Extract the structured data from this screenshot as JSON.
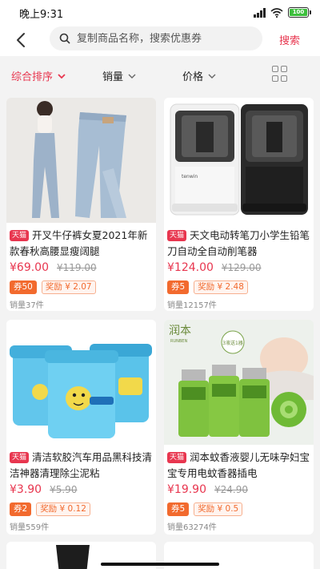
{
  "status": {
    "time": "晚上9:31",
    "battery": "100"
  },
  "search": {
    "placeholder": "复制商品名称，搜索优惠券",
    "button_label": "搜索"
  },
  "sort": {
    "items": [
      "综合排序",
      "销量",
      "价格"
    ]
  },
  "products": [
    {
      "badge": "天猫",
      "title": "开叉牛仔裤女夏2021年新款春秋高腰显瘦阔腿",
      "price": "¥69.00",
      "original_price": "¥119.00",
      "coupon": "券50",
      "reward": "奖励 ¥ 2.07",
      "sales": "销量37件"
    },
    {
      "badge": "天猫",
      "title": "天文电动转笔刀小学生铅笔刀自动全自动削笔器",
      "price": "¥124.00",
      "original_price": "¥129.00",
      "coupon": "券5",
      "reward": "奖励 ¥ 2.48",
      "sales": "销量12157件",
      "brand_on_image": "tenwin"
    },
    {
      "badge": "天猫",
      "title": "清洁软胶汽车用品黑科技清洁神器清理除尘泥粘",
      "price": "¥3.90",
      "original_price": "¥5.90",
      "coupon": "券2",
      "reward": "奖励 ¥ 0.12",
      "sales": "销量559件"
    },
    {
      "badge": "天猫",
      "title": "润本蚊香液婴儿无味孕妇宝宝专用电蚊香器插电",
      "price": "¥19.90",
      "original_price": "¥24.90",
      "coupon": "券5",
      "reward": "奖励 ¥ 0.5",
      "sales": "销量63274件",
      "brand_on_image": "润本",
      "brand_sub": "RUNBEN",
      "promo_on_image": "3液送1器"
    }
  ],
  "colors": {
    "accent": "#e8364f",
    "coupon": "#f26a2e",
    "background": "#f3f3f3"
  },
  "icons": [
    "back-arrow-icon",
    "search-icon",
    "chevron-down-icon",
    "grid-view-icon",
    "signal-icon",
    "wifi-icon",
    "battery-icon"
  ]
}
